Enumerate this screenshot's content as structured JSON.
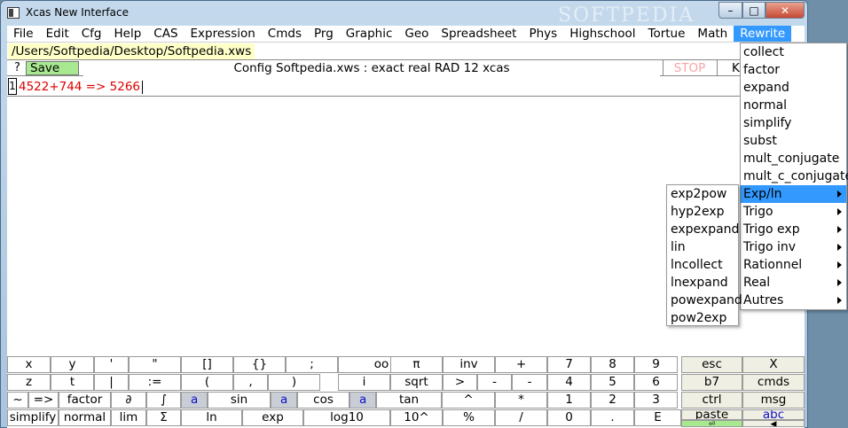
{
  "window": {
    "title": "Xcas New Interface",
    "watermark": "SOFTPEDIA",
    "minimize_glyph": "–",
    "maximize_glyph": "□",
    "close_glyph": "✕"
  },
  "menubar": [
    "File",
    "Edit",
    "Cfg",
    "Help",
    "CAS",
    "Expression",
    "Cmds",
    "Prg",
    "Graphic",
    "Geo",
    "Spreadsheet",
    "Phys",
    "Highschool",
    "Tortue",
    "Math",
    "Rewrite"
  ],
  "path": "/Users/Softpedia/Desktop/Softpedia.xws",
  "config": {
    "help": "?",
    "save": "Save",
    "text": "Config Softpedia.xws : exact real RAD 12 xcas",
    "stop": "STOP",
    "kbd": "K"
  },
  "entry": {
    "number": "1",
    "text": "4522+744 => 5266"
  },
  "rewrite_menu": [
    {
      "label": "collect",
      "submenu": false
    },
    {
      "label": "factor",
      "submenu": false
    },
    {
      "label": "expand",
      "submenu": false
    },
    {
      "label": "normal",
      "submenu": false
    },
    {
      "label": "simplify",
      "submenu": false
    },
    {
      "label": "subst",
      "submenu": false
    },
    {
      "label": "mult_conjugate",
      "submenu": false
    },
    {
      "label": "mult_c_conjugate",
      "submenu": false
    },
    {
      "label": "Exp/ln",
      "submenu": true,
      "active": true
    },
    {
      "label": "Trigo",
      "submenu": true
    },
    {
      "label": "Trigo exp",
      "submenu": true
    },
    {
      "label": "Trigo inv",
      "submenu": true
    },
    {
      "label": "Rationnel",
      "submenu": true
    },
    {
      "label": "Real",
      "submenu": true
    },
    {
      "label": "Autres",
      "submenu": true
    }
  ],
  "expln_submenu": [
    "exp2pow",
    "hyp2exp",
    "expexpand",
    "lin",
    "lncollect",
    "lnexpand",
    "powexpand",
    "pow2exp"
  ],
  "keyboard": {
    "row1": [
      "x",
      "y",
      "'",
      "\"",
      "[]",
      "{}",
      ";",
      "oo",
      "π",
      "inv",
      "+",
      "7",
      "8",
      "9",
      "esc",
      "X"
    ],
    "row2": [
      "z",
      "t",
      "|",
      ":=",
      "(",
      ",",
      ")",
      "i",
      "sqrt",
      ">",
      "-",
      "-",
      "4",
      "5",
      "6",
      "b7",
      "cmds"
    ],
    "row3": [
      "~",
      "=>",
      "factor",
      "∂",
      "∫",
      "a",
      "sin",
      "a",
      "cos",
      "a",
      "tan",
      "^",
      "*",
      "1",
      "2",
      "3",
      "ctrl",
      "msg"
    ],
    "row4": [
      "simplify",
      "normal",
      "lim",
      "Σ",
      "ln",
      "exp",
      "log10",
      "10^",
      "%",
      "/",
      "0",
      ".",
      "E",
      "paste",
      "abc"
    ],
    "row5_extra": [
      "⏎",
      "◀"
    ]
  }
}
